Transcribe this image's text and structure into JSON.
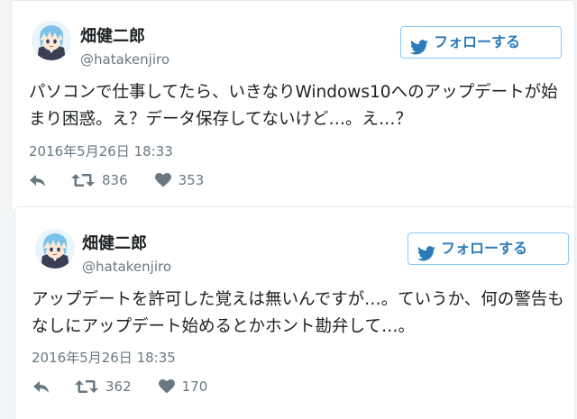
{
  "tweets": [
    {
      "name": "畑健二郎",
      "handle": "@hatakenjiro",
      "follow_label": "フォローする",
      "text": "パソコンで仕事してたら、いきなりWindows10へのアップデートが始まり困惑。え？データ保存してないけど…。え…？",
      "date": "2016年5月26日 18:33",
      "retweets": "836",
      "likes": "353"
    },
    {
      "name": "畑健二郎",
      "handle": "@hatakenjiro",
      "follow_label": "フォローする",
      "text": "アップデートを許可した覚えは無いんですが…。ていうか、何の警告もなしにアップデート始めるとかホント勘弁して…。",
      "date": "2016年5月26日 18:35",
      "retweets": "362",
      "likes": "170"
    }
  ],
  "icons": {
    "reply": "reply-icon",
    "retweet": "retweet-icon",
    "like": "heart-icon",
    "bird": "twitter-bird-icon"
  },
  "colors": {
    "accent": "#2b7bb9",
    "button_border": "#88c9f9",
    "muted_text": "#697882",
    "text": "#1c2022"
  }
}
